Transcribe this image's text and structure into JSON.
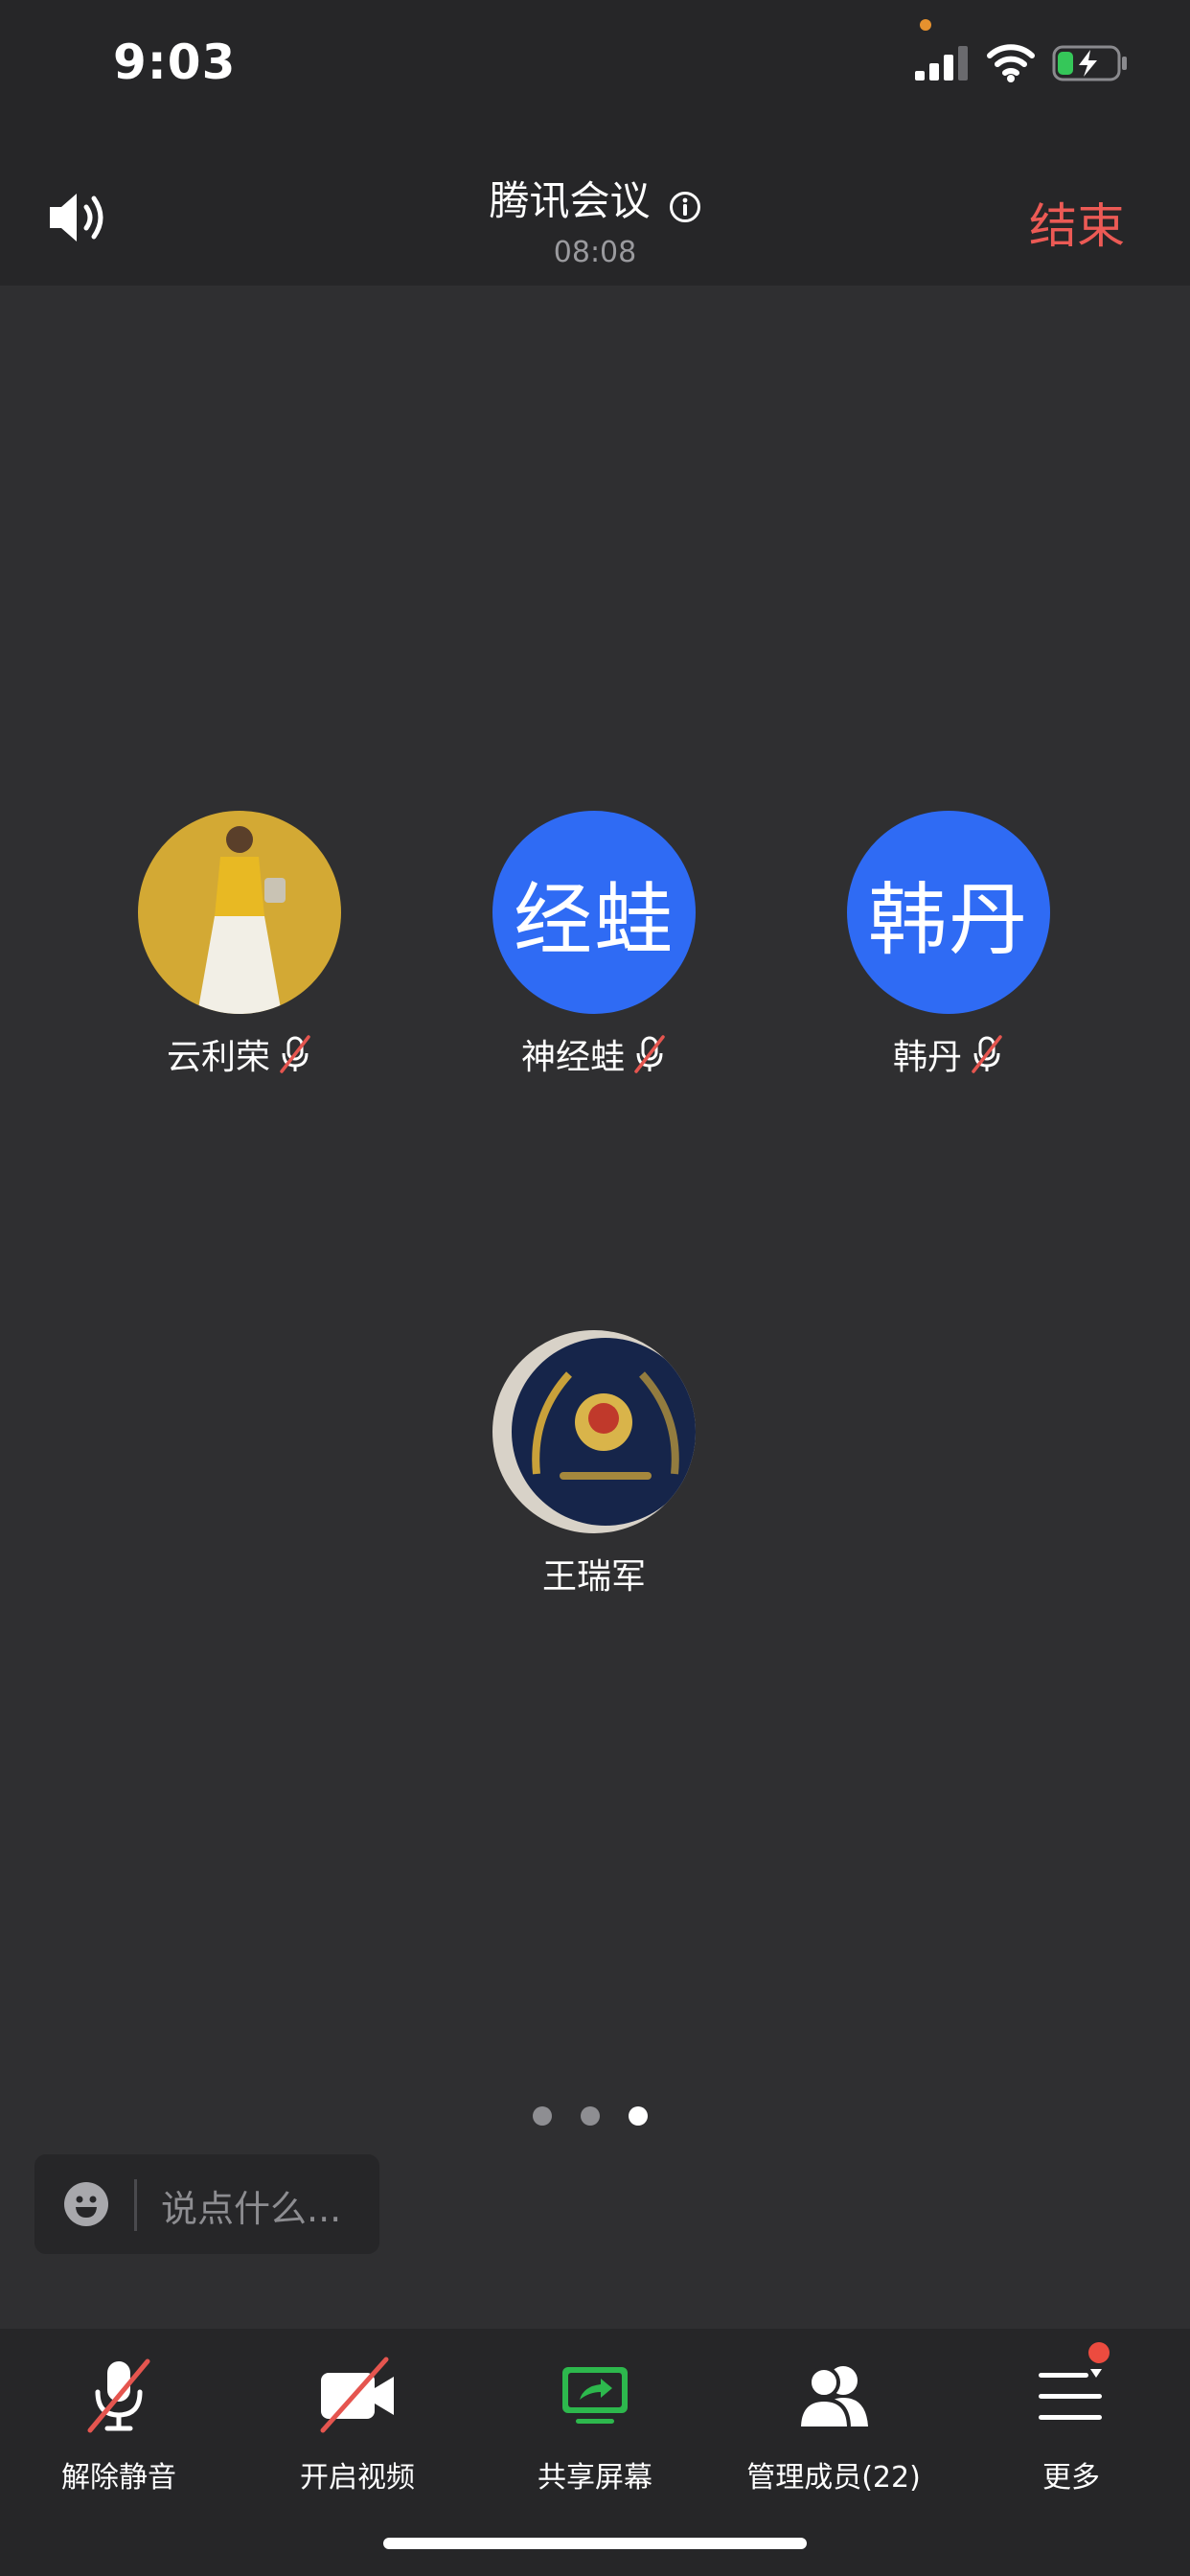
{
  "status_bar": {
    "time": "9:03"
  },
  "header": {
    "title": "腾讯会议",
    "duration": "08:08",
    "end_label": "结束"
  },
  "participants": [
    {
      "name": "云利荣",
      "avatar_type": "photo",
      "muted": true
    },
    {
      "name": "神经蛙",
      "avatar_text": "经蛙",
      "avatar_color": "#2f6bf4",
      "muted": true
    },
    {
      "name": "韩丹",
      "avatar_text": "韩丹",
      "avatar_color": "#2f6bf4",
      "muted": true
    },
    {
      "name": "王瑞军",
      "avatar_type": "photo",
      "muted": false
    }
  ],
  "pagination": {
    "total": 3,
    "current": 3
  },
  "chat": {
    "placeholder": "说点什么..."
  },
  "toolbar": {
    "unmute": "解除静音",
    "start_video": "开启视频",
    "share_screen": "共享屏幕",
    "manage_members": "管理成员(22)",
    "more": "更多"
  },
  "colors": {
    "accent_blue": "#2f6bf4",
    "end_red": "#ec5a55",
    "share_green": "#2db84d",
    "background": "#2f2f31"
  }
}
